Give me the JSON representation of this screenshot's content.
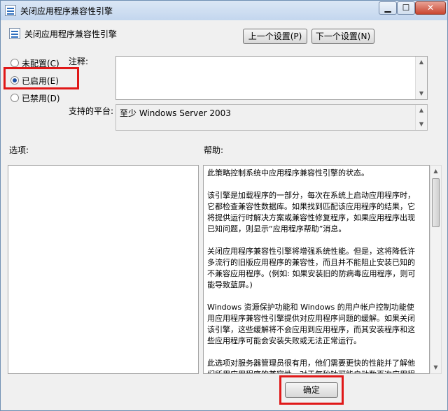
{
  "window": {
    "title": "关闭应用程序兼容性引擎"
  },
  "header": {
    "policy_name": "关闭应用程序兼容性引擎",
    "prev_button": "上一个设置(P)",
    "next_button": "下一个设置(N)"
  },
  "state": {
    "options": [
      {
        "label": "未配置(C)",
        "selected": false
      },
      {
        "label": "已启用(E)",
        "selected": true
      },
      {
        "label": "已禁用(D)",
        "selected": false
      }
    ]
  },
  "comment": {
    "label": "注释:",
    "value": ""
  },
  "platform": {
    "label": "支持的平台:",
    "value": "至少 Windows Server 2003"
  },
  "options_section": {
    "label": "选项:"
  },
  "help_section": {
    "label": "帮助:",
    "paragraphs": [
      "此策略控制系统中应用程序兼容性引擎的状态。",
      "该引擎是加载程序的一部分，每次在系统上启动应用程序时，它都检查兼容性数据库。如果找到匹配该应用程序的结果，它将提供运行时解决方案或兼容性修复程序，如果应用程序出现已知问题，则显示“应用程序帮助”消息。",
      "关闭应用程序兼容性引擎将增强系统性能。但是，这将降低许多流行的旧版应用程序的兼容性，而且并不能阻止安装已知的不兼容应用程序。(例如: 如果安装旧的防病毒应用程序，则可能导致蓝屏。)",
      "Windows 资源保护功能和 Windows 的用户帐户控制功能使用应用程序兼容性引擎提供对应用程序问题的缓解。如果关闭该引擎，这些缓解将不会应用到应用程序，而其安装程序和这些应用程序可能会安装失败或无法正常运行。",
      "此选项对服务器管理员很有用，他们需要更快的性能并了解他们所用应用程序的兼容性。对于每秒钟可能启动数百次应用程序且加载"
    ]
  },
  "footer": {
    "ok_button": "确定"
  },
  "icons": {
    "title": "policy-setting-icon",
    "minimize": "minimize-icon",
    "maximize": "maximize-icon",
    "close": "close-icon"
  },
  "colors": {
    "highlight": "#e01818",
    "window_frame": "#6f8fb3",
    "radio_dot": "#1d4f9f"
  }
}
